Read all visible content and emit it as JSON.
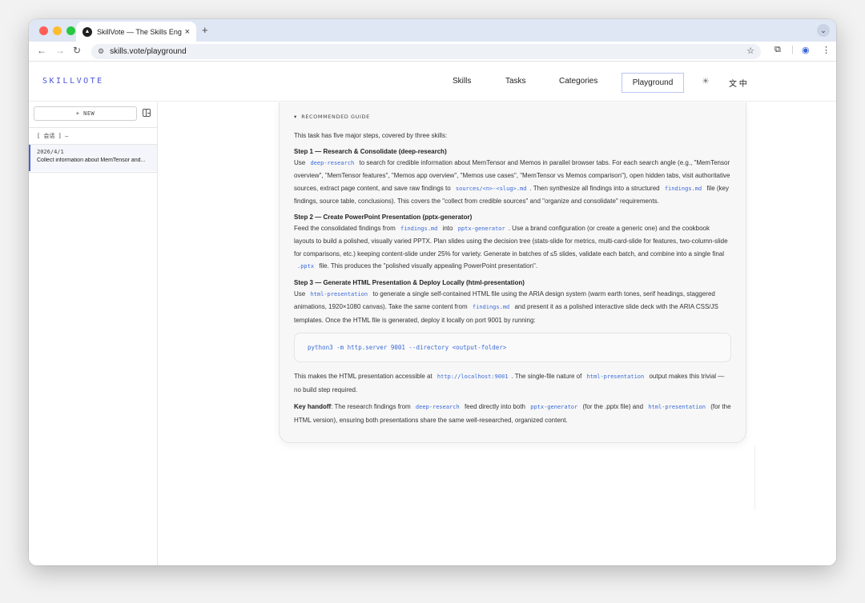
{
  "browser": {
    "tab_title": "SkillVote — The Skills Engine",
    "tab_close": "×",
    "new_tab": "+",
    "url": "skills.vote/playground",
    "menu_chevron": "⌄"
  },
  "site": {
    "logo": "SKILLVOTE",
    "nav": [
      {
        "label": "Skills"
      },
      {
        "label": "Tasks"
      },
      {
        "label": "Categories"
      },
      {
        "label": "Playground"
      }
    ],
    "lang_label": "文 中"
  },
  "sidebar": {
    "new_button": "+ NEW",
    "section_label": "[ 会话 ] —",
    "sessions": [
      {
        "date": "2026/4/1",
        "title": "Collect information about MemTensor and..."
      }
    ]
  },
  "guide": {
    "label": "RECOMMENDED GUIDE",
    "intro": "This task has five major steps, covered by three skills:",
    "step1": {
      "title": "Step 1 — Research & Consolidate (deep-research)",
      "t1": "Use",
      "c1": "deep-research",
      "t2": "to search for credible information about MemTensor and Memos in parallel browser tabs. For each search angle (e.g., \"MemTensor overview\", \"MemTensor features\", \"Memos app overview\", \"Memos use cases\", \"MemTensor vs Memos comparison\"), open hidden tabs, visit authoritative sources, extract page content, and save raw findings to",
      "c2": "sources/<n>-<slug>.md",
      "t3": ". Then synthesize all findings into a structured",
      "c3": "findings.md",
      "t4": "file (key findings, source table, conclusions). This covers the \"collect from credible sources\" and \"organize and consolidate\" requirements."
    },
    "step2": {
      "title": "Step 2 — Create PowerPoint Presentation (pptx-generator)",
      "t1": "Feed the consolidated findings from",
      "c1": "findings.md",
      "t2": "into",
      "c2": "pptx-generator",
      "t3": ". Use a brand configuration (or create a generic one) and the cookbook layouts to build a polished, visually varied PPTX. Plan slides using the decision tree (stats-slide for metrics, multi-card-slide for features, two-column-slide for comparisons, etc.) keeping content-slide under 25% for variety. Generate in batches of ≤5 slides, validate each batch, and combine into a single final",
      "c3": ".pptx",
      "t4": "file. This produces the \"polished visually appealing PowerPoint presentation\"."
    },
    "step3": {
      "title": "Step 3 — Generate HTML Presentation & Deploy Locally (html-presentation)",
      "t1": "Use",
      "c1": "html-presentation",
      "t2": "to generate a single self-contained HTML file using the ARIA design system (warm earth tones, serif headings, staggered animations, 1920×1080 canvas). Take the same content from",
      "c2": "findings.md",
      "t3": "and present it as a polished interactive slide deck with the ARIA CSS/JS templates. Once the HTML file is generated, deploy it locally on port 9001 by running:"
    },
    "command": "python3 -m http.server 9001 --directory <output-folder>",
    "after": {
      "t1": "This makes the HTML presentation accessible at",
      "c1": "http://localhost:9001",
      "t2": ". The single-file nature of",
      "c2": "html-presentation",
      "t3": "output makes this trivial — no build step required."
    },
    "handoff": {
      "label": "Key handoff",
      "t1": ": The research findings from",
      "c1": "deep-research",
      "t2": "feed directly into both",
      "c2": "pptx-generator",
      "t3": "(for the .pptx file) and",
      "c3": "html-presentation",
      "t4": "(for the HTML version), ensuring both presentations share the same well-researched, organized content."
    }
  }
}
